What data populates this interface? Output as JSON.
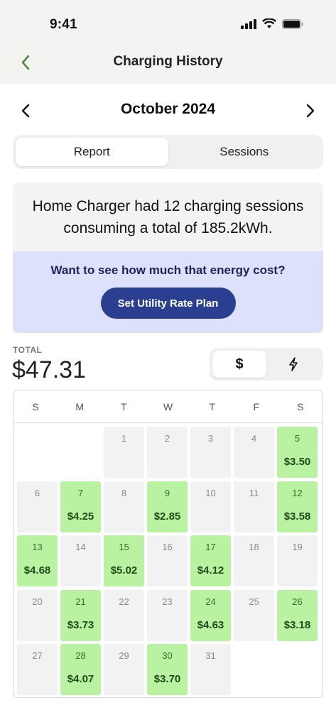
{
  "status_bar": {
    "time": "9:41"
  },
  "nav": {
    "title": "Charging History"
  },
  "month": {
    "label": "October 2024"
  },
  "tabs": [
    {
      "label": "Report",
      "active": true
    },
    {
      "label": "Sessions",
      "active": false
    }
  ],
  "summary": {
    "text": "Home Charger had 12 charging sessions consuming a total of 185.2kWh.",
    "promo_question": "Want to see how much that energy cost?",
    "promo_button": "Set Utility Rate Plan"
  },
  "total": {
    "label": "TOTAL",
    "value": "$47.31"
  },
  "unit_toggle": {
    "options": [
      "$",
      "bolt-icon"
    ],
    "selected": "$"
  },
  "calendar": {
    "weekdays": [
      "S",
      "M",
      "T",
      "W",
      "T",
      "F",
      "S"
    ],
    "first_weekday_index": 2,
    "days": [
      {
        "day": "1",
        "amount": ""
      },
      {
        "day": "2",
        "amount": ""
      },
      {
        "day": "3",
        "amount": ""
      },
      {
        "day": "4",
        "amount": ""
      },
      {
        "day": "5",
        "amount": "$3.50"
      },
      {
        "day": "6",
        "amount": ""
      },
      {
        "day": "7",
        "amount": "$4.25"
      },
      {
        "day": "8",
        "amount": ""
      },
      {
        "day": "9",
        "amount": "$2.85"
      },
      {
        "day": "10",
        "amount": ""
      },
      {
        "day": "11",
        "amount": ""
      },
      {
        "day": "12",
        "amount": "$3.58"
      },
      {
        "day": "13",
        "amount": "$4.68"
      },
      {
        "day": "14",
        "amount": ""
      },
      {
        "day": "15",
        "amount": "$5.02"
      },
      {
        "day": "16",
        "amount": ""
      },
      {
        "day": "17",
        "amount": "$4.12"
      },
      {
        "day": "18",
        "amount": ""
      },
      {
        "day": "19",
        "amount": ""
      },
      {
        "day": "20",
        "amount": ""
      },
      {
        "day": "21",
        "amount": "$3.73"
      },
      {
        "day": "22",
        "amount": ""
      },
      {
        "day": "23",
        "amount": ""
      },
      {
        "day": "24",
        "amount": "$4.63"
      },
      {
        "day": "25",
        "amount": ""
      },
      {
        "day": "26",
        "amount": "$3.18"
      },
      {
        "day": "27",
        "amount": ""
      },
      {
        "day": "28",
        "amount": "$4.07"
      },
      {
        "day": "29",
        "amount": ""
      },
      {
        "day": "30",
        "amount": "$3.70"
      },
      {
        "day": "31",
        "amount": ""
      }
    ]
  },
  "colors": {
    "accent_green": "#b9f3a1",
    "primary_button": "#2a3f8f",
    "promo_bg": "#dde1fb",
    "back_arrow": "#4b8a3a"
  }
}
